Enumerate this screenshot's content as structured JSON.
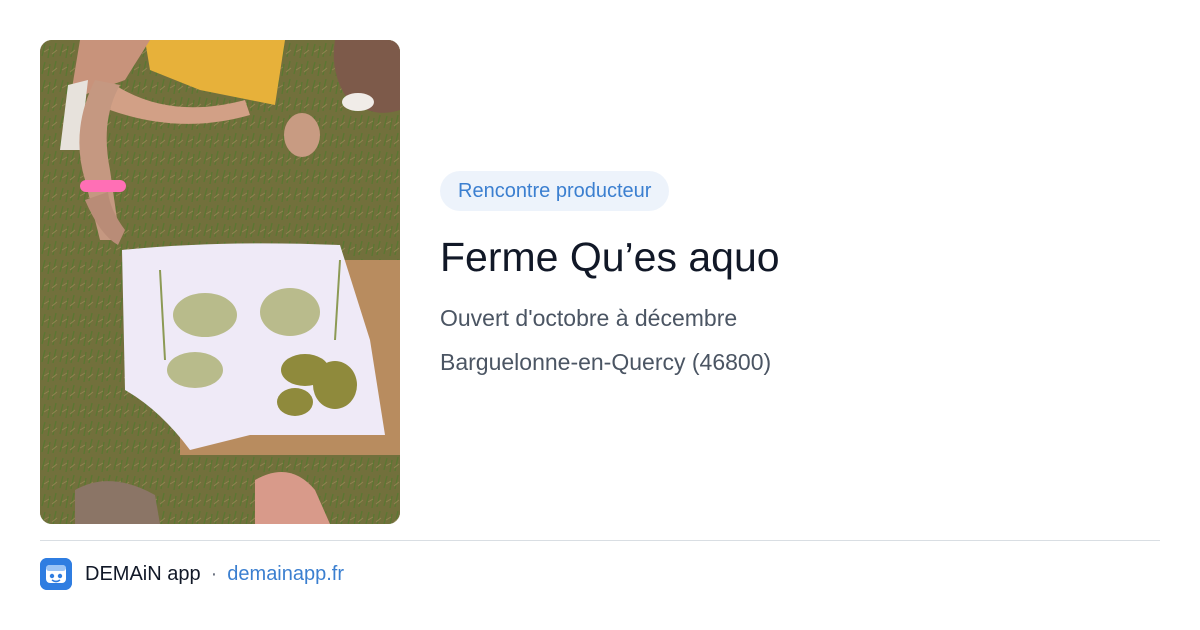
{
  "card": {
    "image": {
      "description_icon": "photo-image"
    },
    "tag": "Rencontre producteur",
    "title": "Ferme Qu’es aquo",
    "details": [
      "Ouvert d'octobre à décembre",
      "Barguelonne-en-Quercy (46800)"
    ]
  },
  "footer": {
    "logo_icon": "demain-app-logo-icon",
    "app_name": "DEMAiN app",
    "separator": "·",
    "site": "demainapp.fr"
  },
  "colors": {
    "accent": "#3b7fd0",
    "tag_background": "#edf3fb",
    "title": "#111827",
    "meta": "#4b5563",
    "logo": "#2f7de1"
  }
}
